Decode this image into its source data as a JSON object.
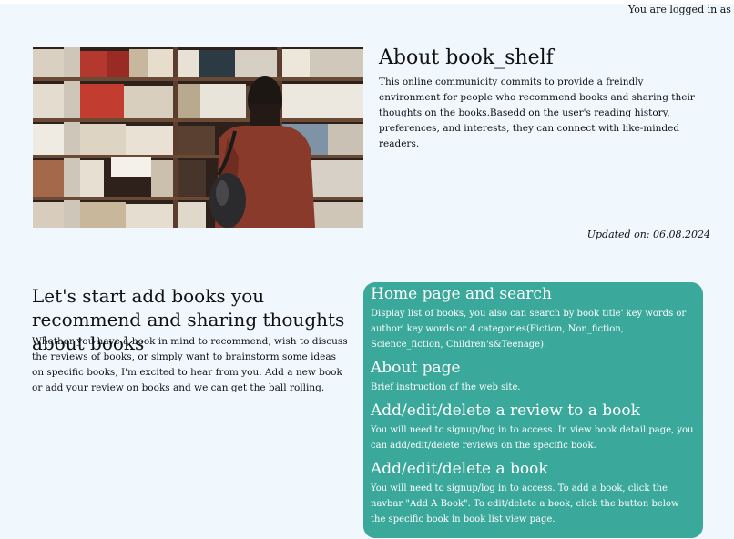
{
  "header": {
    "login_status": "You are logged in as admin"
  },
  "about": {
    "title": "About book_shelf",
    "text": "This online communicity commits to provide a freindly environment for people who recommend books and sharing their thoughts on the books.Basedd on the user's reading history, preferences, and interests, they can connect with like-minded readers.",
    "updated": "Updated on: 06.08.2024"
  },
  "intro": {
    "title": "Let's start add books you recommend and sharing thoughts about books",
    "text": "Whether you have a book in mind to recommend, wish to discuss the reviews of books, or simply want to brainstorm some ideas on specific books, I'm excited to hear from you. Add a new book or add your review on books and we can get the ball rolling."
  },
  "features": [
    {
      "title": "Home page and search",
      "text": "Display list of books, you also can search by book title' key words or author' key words or 4 categories(Fiction, Non_fiction, Science_fiction, Children's&Teenage)."
    },
    {
      "title": "About page",
      "text": "Brief instruction of the web site."
    },
    {
      "title": "Add/edit/delete a review to a book",
      "text": "You will need to signup/log in to access. In view book detail page, you can add/edit/delete reviews on the specific book."
    },
    {
      "title": "Add/edit/delete a book",
      "text": "You will need to signup/log in to access. To add a book, click the navbar \"Add A Book\". To edit/delete a book, click the button below the specific book in book list view page."
    }
  ],
  "colors": {
    "page_background": "#f0f7fd",
    "panel_background": "#3aa89b",
    "panel_text": "#ffffff"
  },
  "image": {
    "subject": "person-browsing-bookshelf-photo"
  }
}
